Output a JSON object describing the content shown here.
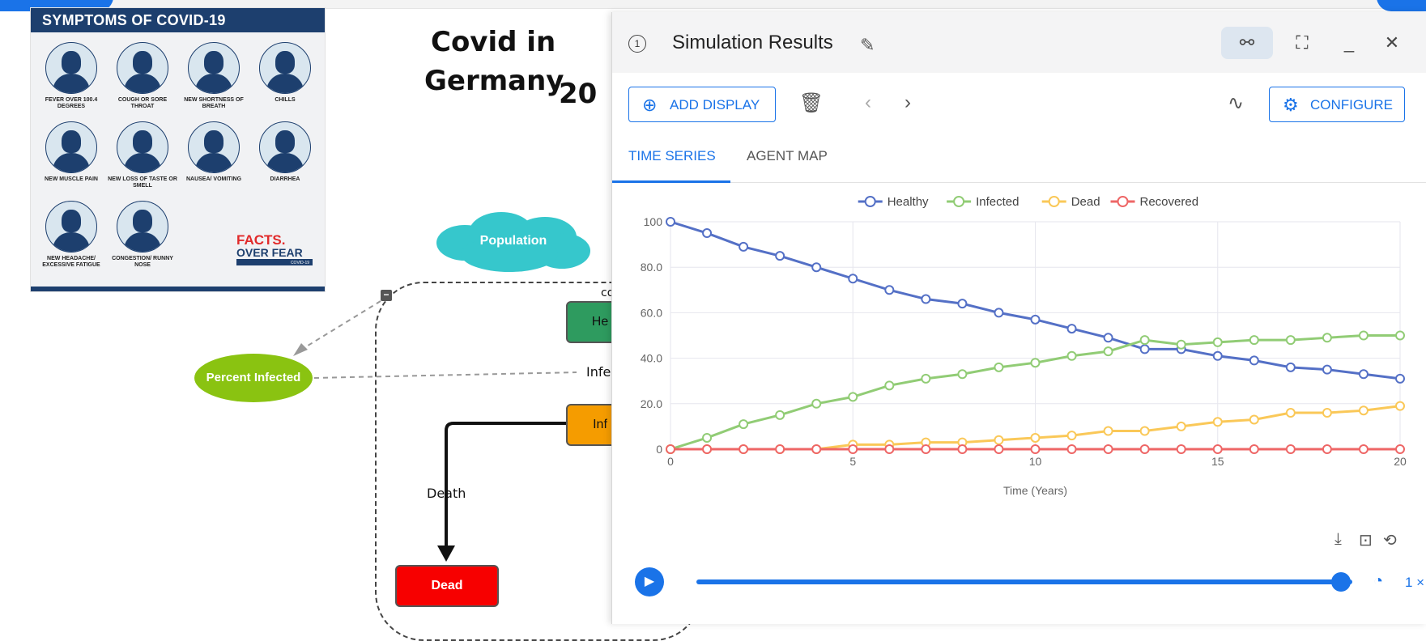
{
  "poster": {
    "title": "SYMPTOMS OF COVID-19",
    "symptoms": [
      {
        "label": "FEVER OVER 100.4 DEGREES",
        "icon": "fever-icon"
      },
      {
        "label": "COUGH OR SORE THROAT",
        "icon": "cough-icon"
      },
      {
        "label": "NEW SHORTNESS OF BREATH",
        "icon": "breath-icon"
      },
      {
        "label": "CHILLS",
        "icon": "chills-icon"
      },
      {
        "label": "NEW MUSCLE PAIN",
        "icon": "muscle-pain-icon"
      },
      {
        "label": "NEW LOSS OF TASTE OR SMELL",
        "icon": "taste-smell-icon"
      },
      {
        "label": "NAUSEA/ VOMITING",
        "icon": "nausea-icon"
      },
      {
        "label": "DIARRHEA",
        "icon": "diarrhea-icon"
      },
      {
        "label": "NEW HEADACHE/ EXCESSIVE FATIGUE",
        "icon": "headache-icon"
      },
      {
        "label": "CONGESTION/ RUNNY NOSE",
        "icon": "congestion-icon"
      }
    ],
    "brand_line1": "FACTS.",
    "brand_line2": "OVER FEAR",
    "brand_line3": "COVID-19",
    "colors": {
      "navy": "#1d3f6e",
      "red": "#e12a2a"
    }
  },
  "model": {
    "title_line1": "Covid in",
    "title_line2": "Germany",
    "title_year_fragment": "20",
    "population_label": "Population",
    "percent_infected_label": "Percent Infected",
    "healthy_fragment": "He",
    "infected_fragment": "Inf",
    "flow_fragment": "Infe",
    "flow_fragment_2": "co",
    "death_flow_label": "Death",
    "dead_label": "Dead",
    "colors": {
      "population": "#36c7cc",
      "percent_infected": "#8ac311",
      "dead": "#f70000",
      "healthy": "#2e9b5f",
      "infected": "#f59c00"
    }
  },
  "window": {
    "title": "Simulation Results",
    "info_icon": "info-icon",
    "edit_icon": "pencil-icon",
    "header_buttons": [
      "model-map-icon",
      "fullscreen-icon",
      "minimize-icon",
      "close-icon"
    ],
    "add_display_label": "ADD DISPLAY",
    "configure_label": "CONFIGURE",
    "tabs": [
      {
        "label": "TIME SERIES",
        "active": true
      },
      {
        "label": "AGENT MAP",
        "active": false
      }
    ],
    "speed_label": "1 ×",
    "playback_progress": 1.0,
    "accent": "#1a73e8"
  },
  "chart_data": {
    "type": "line",
    "xlabel": "Time (Years)",
    "ylabel": "",
    "xlim": [
      0,
      20
    ],
    "ylim": [
      0,
      100
    ],
    "x_ticks": [
      "0",
      "5",
      "10",
      "15",
      "20"
    ],
    "y_ticks": [
      "0",
      "20.0",
      "40.0",
      "60.0",
      "80.0",
      "100"
    ],
    "grid": true,
    "legend_position": "top-center",
    "x": [
      0,
      1,
      2,
      3,
      4,
      5,
      6,
      7,
      8,
      9,
      10,
      11,
      12,
      13,
      14,
      15,
      16,
      17,
      18,
      19,
      20
    ],
    "series": [
      {
        "name": "Healthy",
        "color": "#5470c6",
        "values": [
          100,
          95,
          89,
          85,
          80,
          75,
          70,
          66,
          64,
          60,
          57,
          53,
          49,
          44,
          44,
          41,
          39,
          36,
          35,
          33,
          31
        ]
      },
      {
        "name": "Infected",
        "color": "#91cc75",
        "values": [
          0,
          5,
          11,
          15,
          20,
          23,
          28,
          31,
          33,
          36,
          38,
          41,
          43,
          48,
          46,
          47,
          48,
          48,
          49,
          50,
          50
        ]
      },
      {
        "name": "Dead",
        "color": "#fac858",
        "values": [
          0,
          0,
          0,
          0,
          0,
          2,
          2,
          3,
          3,
          4,
          5,
          6,
          8,
          8,
          10,
          12,
          13,
          16,
          16,
          17,
          19
        ]
      },
      {
        "name": "Recovered",
        "color": "#ee6666",
        "values": [
          0,
          0,
          0,
          0,
          0,
          0,
          0,
          0,
          0,
          0,
          0,
          0,
          0,
          0,
          0,
          0,
          0,
          0,
          0,
          0,
          0
        ]
      }
    ]
  }
}
